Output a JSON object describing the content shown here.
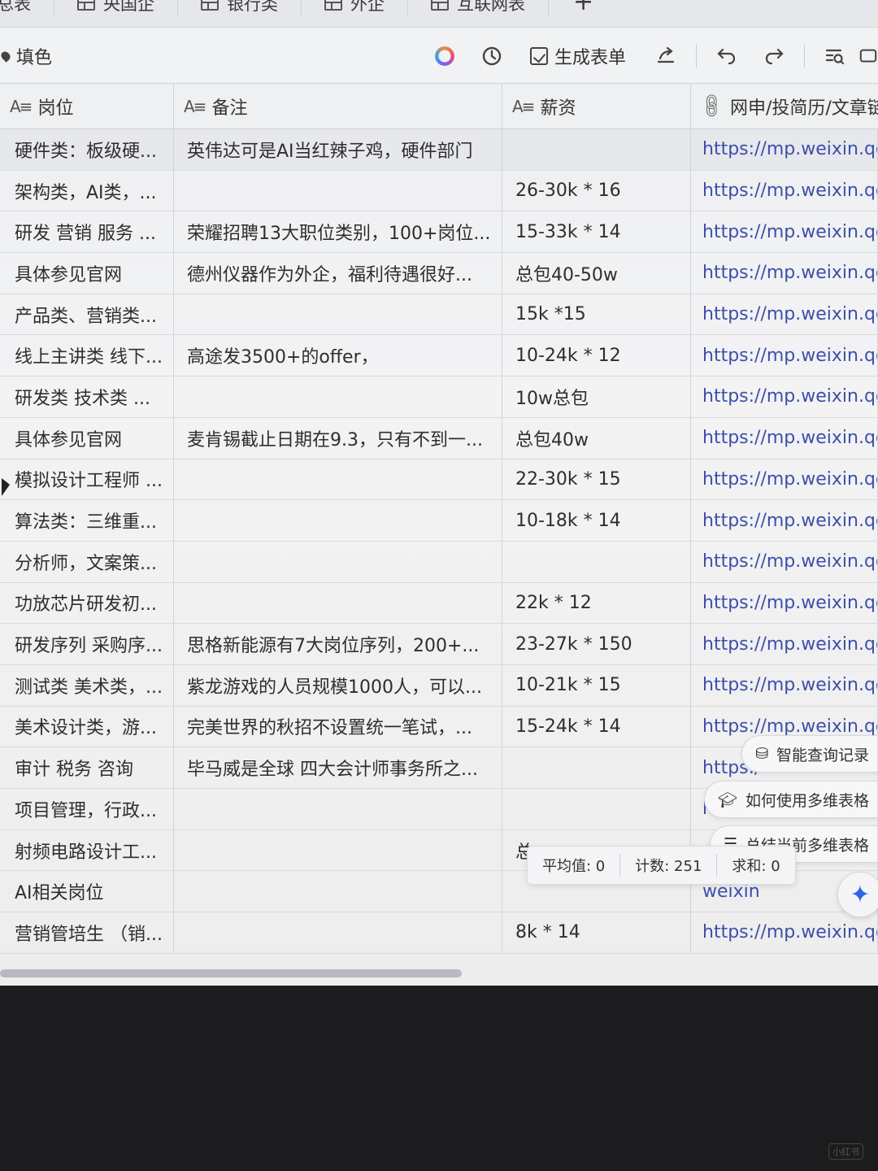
{
  "tabs": [
    {
      "label": "总表",
      "icon": "none"
    },
    {
      "label": "央国企",
      "icon": "grid-icon"
    },
    {
      "label": "银行类",
      "icon": "grid-icon"
    },
    {
      "label": "外企",
      "icon": "grid-icon"
    },
    {
      "label": "互联网表",
      "icon": "grid-icon"
    }
  ],
  "add_tab": "+",
  "toolbar": {
    "fill_label": "填色",
    "generate_form_label": "生成表单"
  },
  "columns": [
    {
      "label": "岗位",
      "type_icon": "A≡"
    },
    {
      "label": "备注",
      "type_icon": "A≡"
    },
    {
      "label": "薪资",
      "type_icon": "A≡"
    },
    {
      "label": "网申/投简历/文章链",
      "type_icon": "link-icon"
    }
  ],
  "rows": [
    {
      "position": "硬件类：板级硬...",
      "note": "英伟达可是AI当红辣子鸡，硬件部门",
      "salary": "",
      "link": "https://mp.weixin.qq."
    },
    {
      "position": "架构类，AI类，...",
      "note": "",
      "salary": "26-30k * 16",
      "link": "https://mp.weixin.qq."
    },
    {
      "position": "研发 营销 服务 ...",
      "note": "荣耀招聘13大职位类别，100+岗位...",
      "salary": "15-33k * 14",
      "link": "https://mp.weixin.qq."
    },
    {
      "position": "具体参见官网",
      "note": "德州仪器作为外企，福利待遇很好...",
      "salary": "总包40-50w",
      "link": "https://mp.weixin.qq."
    },
    {
      "position": "产品类、营销类...",
      "note": "",
      "salary": "15k *15",
      "link": "https://mp.weixin.qq."
    },
    {
      "position": "线上主讲类 线下...",
      "note": "高途发3500+的offer，",
      "salary": "10-24k * 12",
      "link": "https://mp.weixin.qq."
    },
    {
      "position": "研发类 技术类 ...",
      "note": "",
      "salary": "10w总包",
      "link": "https://mp.weixin.qq."
    },
    {
      "position": "具体参见官网",
      "note": "麦肯锡截止日期在9.3，只有不到一...",
      "salary": "总包40w",
      "link": "https://mp.weixin.qq."
    },
    {
      "position": "模拟设计工程师 ...",
      "note": "",
      "salary": "22-30k * 15",
      "link": "https://mp.weixin.qq."
    },
    {
      "position": "算法类：三维重...",
      "note": "",
      "salary": "10-18k * 14",
      "link": "https://mp.weixin.qq."
    },
    {
      "position": "分析师，文案策...",
      "note": "",
      "salary": "",
      "link": "https://mp.weixin.qq."
    },
    {
      "position": "功放芯片研发初...",
      "note": "",
      "salary": "22k * 12",
      "link": "https://mp.weixin.qq."
    },
    {
      "position": "研发序列 采购序...",
      "note": "思格新能源有7大岗位序列，200+...",
      "salary": "23-27k * 150",
      "link": "https://mp.weixin.qq."
    },
    {
      "position": "测试类 美术类，...",
      "note": "紫龙游戏的人员规模1000人，可以...",
      "salary": "10-21k * 15",
      "link": "https://mp.weixin.qq."
    },
    {
      "position": "美术设计类，游...",
      "note": "完美世界的秋招不设置统一笔试，...",
      "salary": "15-24k * 14",
      "link": "https://mp.weixin.qq."
    },
    {
      "position": "审计 税务 咨询",
      "note": "毕马威是全球 四大会计师事务所之...",
      "salary": "",
      "link": "https:/"
    },
    {
      "position": "项目管理，行政...",
      "note": "",
      "salary": "",
      "link": "htt"
    },
    {
      "position": "射频电路设计工...",
      "note": "",
      "salary": "总",
      "link": ""
    },
    {
      "position": "AI相关岗位",
      "note": "",
      "salary": "",
      "link": "weixin"
    },
    {
      "position": "营销管培生 （销...",
      "note": "",
      "salary": "8k * 14",
      "link": "https://mp.weixin.qq.c"
    }
  ],
  "ai_menu": [
    {
      "label": "智能查询记录",
      "icon": "database-icon"
    },
    {
      "label": "如何使用多维表格",
      "icon": "graduation-cap-icon"
    },
    {
      "label": "总结当前多维表格",
      "icon": "list-icon"
    }
  ],
  "stats": {
    "average": "平均值: 0",
    "count": "计数: 251",
    "sum": "求和: 0"
  },
  "watermark": "小红书",
  "colors": {
    "link": "#3d4faa",
    "ai_accent": "#2f64e8"
  }
}
